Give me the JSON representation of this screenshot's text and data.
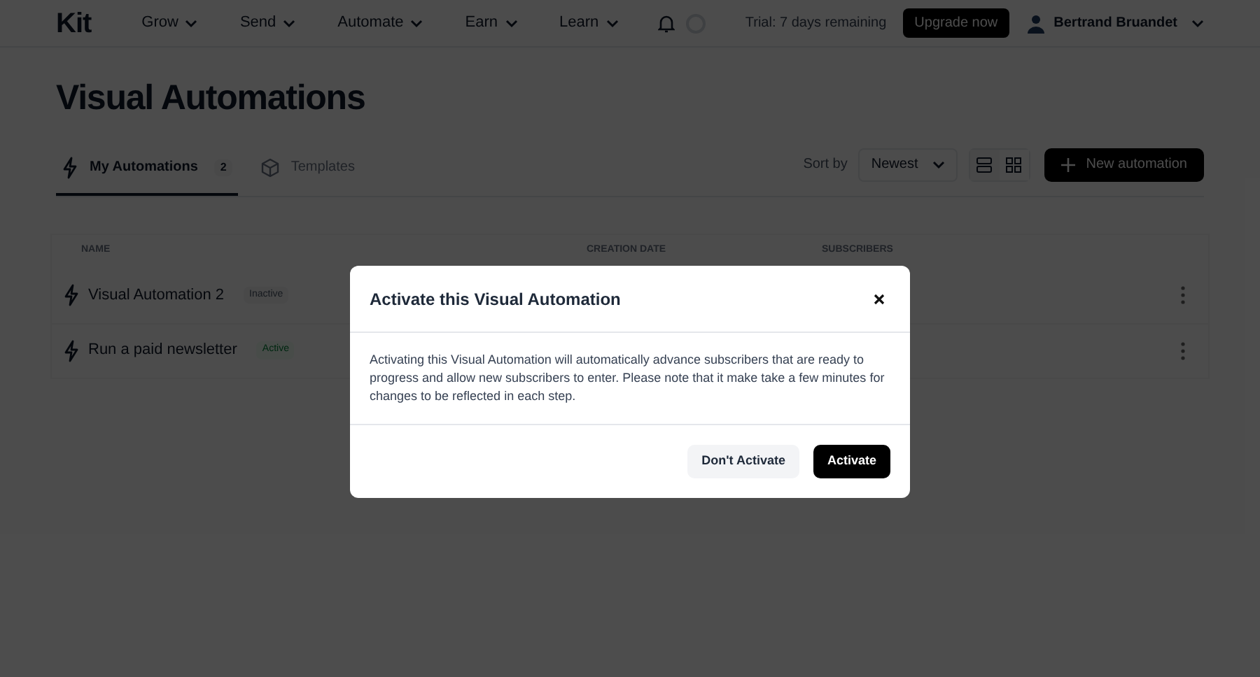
{
  "nav": {
    "logo": "Kit",
    "menus": [
      "Grow",
      "Send",
      "Automate",
      "Earn",
      "Learn"
    ],
    "trial": "Trial: 7 days remaining",
    "upgrade": "Upgrade now",
    "user": "Bertrand Bruandet"
  },
  "page_title": "Visual Automations",
  "tabs": [
    {
      "label": "My Automations",
      "count": "2",
      "selected": true
    },
    {
      "label": "Templates",
      "selected": false
    }
  ],
  "sort": {
    "label": "Sort by",
    "value": "Newest"
  },
  "new_button": "New automation",
  "table": {
    "columns": [
      "NAME",
      "CREATION DATE",
      "SUBSCRIBERS"
    ],
    "rows": [
      {
        "name": "Visual Automation 2",
        "status": "Inactive",
        "active": false
      },
      {
        "name": "Run a paid newsletter",
        "status": "Active",
        "active": true
      }
    ]
  },
  "dialog": {
    "title": "Activate this Visual Automation",
    "body": "Activating this Visual Automation will automatically advance subscribers that are ready to progress and allow new subscribers to enter. Please note that it make take a few minutes for changes to be reflected in each step.",
    "buttons": [
      {
        "label": "Don't Activate",
        "kind": "secondary"
      },
      {
        "label": "Activate",
        "kind": "primary"
      }
    ]
  }
}
